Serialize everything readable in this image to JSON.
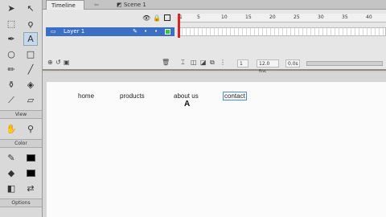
{
  "tabs": {
    "timeline": "Timeline",
    "scene": "Scene 1"
  },
  "layer": {
    "name": "Layer 1"
  },
  "ruler": [
    "1",
    "5",
    "10",
    "15",
    "20",
    "25",
    "30",
    "35",
    "40"
  ],
  "footer": {
    "frame": "1",
    "fps": "12.0 fps",
    "time": "0.0s"
  },
  "tools_panel": {
    "view_label": "View",
    "color_label": "Color",
    "options_label": "Options"
  },
  "nav_links": [
    "home",
    "products",
    "about us",
    "contact"
  ],
  "cursor_glyph": "A",
  "colors": {
    "layer_highlight": "#3a6fc4",
    "playhead": "#d22222",
    "selection": "#4a8fd6"
  }
}
